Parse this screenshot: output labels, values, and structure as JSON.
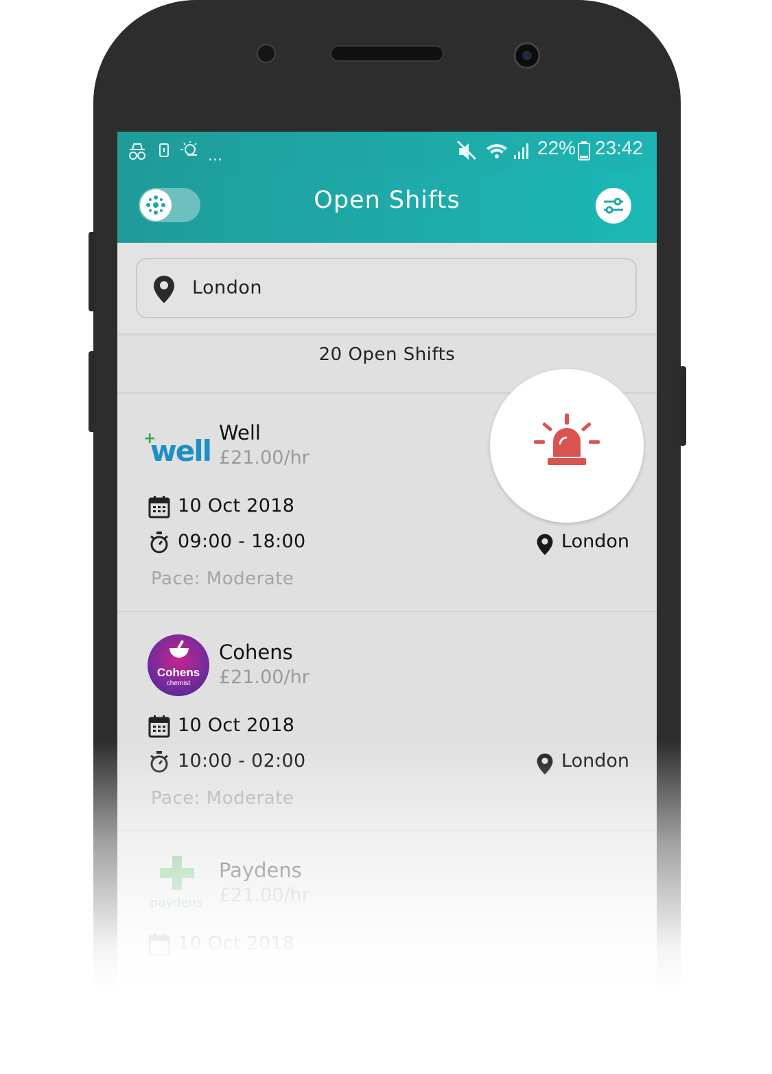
{
  "status_bar": {
    "battery": "22%",
    "time": "23:42",
    "more": "..."
  },
  "app_bar": {
    "title": "Open Shifts"
  },
  "search": {
    "location": "London"
  },
  "shifts_count": "20 Open Shifts",
  "colors": {
    "teal": "#1fa9a7",
    "alert_red": "#d9534f"
  },
  "shifts": [
    {
      "logo_text": "well",
      "name": "Well",
      "rate": "£21.00/hr",
      "date": "10 Oct 2018",
      "time": "09:00 - 18:00",
      "location": "London",
      "pace": "Pace: Moderate",
      "urgent": true
    },
    {
      "logo_text": "Cohens",
      "logo_sub": "chemist",
      "name": "Cohens",
      "rate": "£21.00/hr",
      "date": "10 Oct 2018",
      "time": "10:00 - 02:00",
      "location": "London",
      "pace": "Pace: Moderate",
      "urgent": false
    },
    {
      "logo_text": "paydens",
      "name": "Paydens",
      "rate": "£21.00/hr",
      "date": "10 Oct 2018"
    }
  ]
}
